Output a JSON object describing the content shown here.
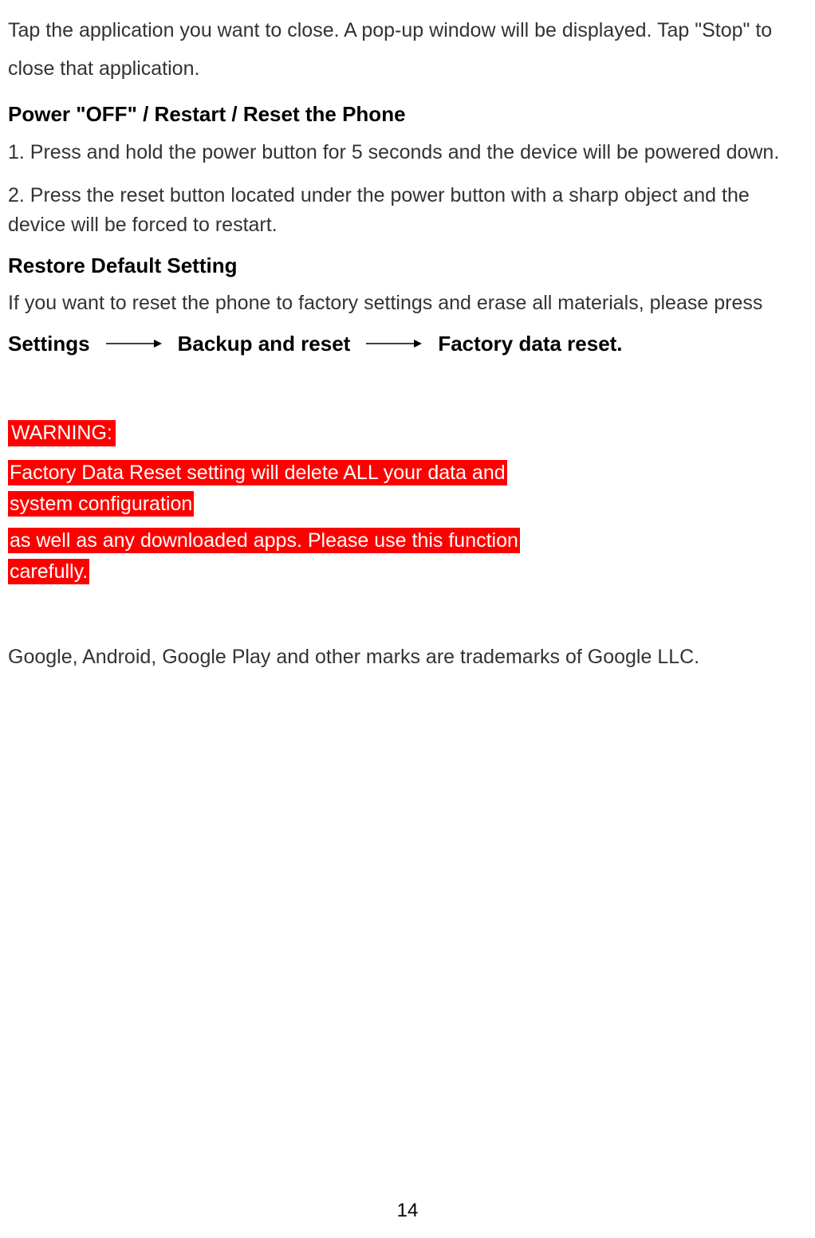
{
  "intro": "Tap the application you want to close. A pop-up window will be displayed. Tap \"Stop\" to close that application.",
  "heading1": "Power \"OFF\" / Restart / Reset the Phone",
  "step1_num": "1.",
  "step1_text": " Press and hold the power button for 5 seconds and the device will be powered down.",
  "step2_num": "2.",
  "step2_text": " Press the reset button located under the power button with a sharp object and the device will be forced to restart.",
  "heading2": "Restore Default Setting",
  "restore_intro": "If you want to reset the phone to factory settings and erase all materials, please press",
  "path": {
    "settings": "Settings",
    "backup": "Backup and reset",
    "factory": "Factory data reset."
  },
  "warning_label": "WARNING:",
  "warning_l1a": "Factory Data Reset setting will delete ALL your data and",
  "warning_l1b": "system configuration",
  "warning_l2a": "as well as any downloaded apps. Please use this function",
  "warning_l2b": "carefully.",
  "trademark": "Google, Android, Google Play and other marks are trademarks of Google LLC.",
  "page_number": "14"
}
